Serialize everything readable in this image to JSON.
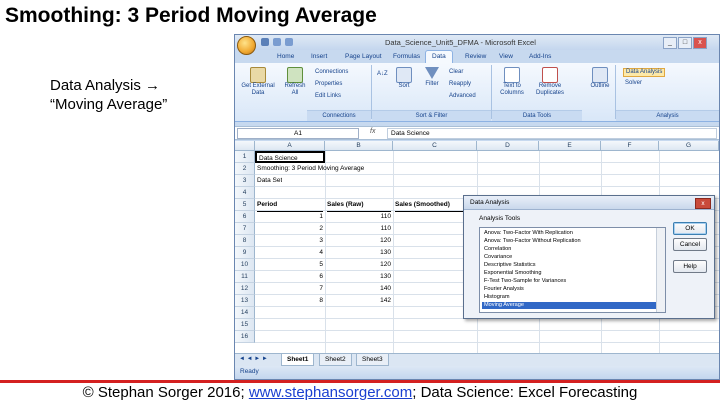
{
  "slide": {
    "title": "Smoothing: 3 Period Moving Average",
    "instruction_line1": "Data Analysis →",
    "instruction_line2": "“Moving Average”",
    "footer_prefix": "© Stephan Sorger 2016; ",
    "footer_link": "www.stephansorger.com",
    "footer_suffix": "; Data Science: Excel Forecasting"
  },
  "excel": {
    "window_title": "Data_Science_Unit5_DFMA - Microsoft Excel",
    "tabs": [
      "Home",
      "Insert",
      "Page Layout",
      "Formulas",
      "Data",
      "Review",
      "View",
      "Add-Ins"
    ],
    "active_tab": "Data",
    "ribbon": {
      "get_external": "Get External",
      "get_external_2": "Data",
      "refresh": "Refresh",
      "refresh_2": "All",
      "connections": "Connections",
      "properties": "Properties",
      "edit_links": "Edit Links",
      "sort_az": "A↓Z",
      "sort": "Sort",
      "filter": "Filter",
      "clear": "Clear",
      "reapply": "Reapply",
      "advanced": "Advanced",
      "text_to_columns": "Text to",
      "text_to_columns_2": "Columns",
      "remove_duplicates": "Remove",
      "remove_duplicates_2": "Duplicates",
      "outline": "Outline",
      "data_analysis": "Data Analysis",
      "solver": "Solver",
      "group_connections": "Connections",
      "group_sort_filter": "Sort & Filter",
      "group_data_tools": "Data Tools",
      "group_analysis": "Analysis"
    },
    "name_box": "A1",
    "fx": "fx",
    "formula_bar": "Data Science",
    "columns": [
      "A",
      "B",
      "C",
      "D",
      "E",
      "F",
      "G"
    ],
    "rows": [
      "1",
      "2",
      "3",
      "4",
      "5",
      "6",
      "7",
      "8",
      "9",
      "10",
      "11",
      "12",
      "13",
      "14",
      "15",
      "16"
    ],
    "cells": {
      "a1": "Data Science",
      "a2": "Smoothing: 3 Period Moving Average",
      "a3": "Data Set",
      "h_period": "Period",
      "h_sales_raw": "Sales (Raw)",
      "h_sales_smooth": "Sales (Smoothed)"
    },
    "data_rows": [
      {
        "period": "1",
        "sales": "110"
      },
      {
        "period": "2",
        "sales": "110"
      },
      {
        "period": "3",
        "sales": "120"
      },
      {
        "period": "4",
        "sales": "130"
      },
      {
        "period": "5",
        "sales": "120"
      },
      {
        "period": "6",
        "sales": "130"
      },
      {
        "period": "7",
        "sales": "140"
      },
      {
        "period": "8",
        "sales": "142"
      }
    ],
    "sheet_tabs": [
      "Sheet1",
      "Sheet2",
      "Sheet3"
    ],
    "status": "Ready"
  },
  "dialog": {
    "title": "Data Analysis",
    "close": "x",
    "tools_label": "Analysis Tools",
    "tools": [
      "Anova: Two-Factor With Replication",
      "Anova: Two-Factor Without Replication",
      "Correlation",
      "Covariance",
      "Descriptive Statistics",
      "Exponential Smoothing",
      "F-Test Two-Sample for Variances",
      "Fourier Analysis",
      "Histogram",
      "Moving Average"
    ],
    "selected_tool": "Moving Average",
    "ok": "OK",
    "cancel": "Cancel",
    "help": "Help"
  },
  "colors": {
    "accent_red": "#d42020",
    "excel_blue": "#15428b",
    "selection": "#3168c6"
  }
}
